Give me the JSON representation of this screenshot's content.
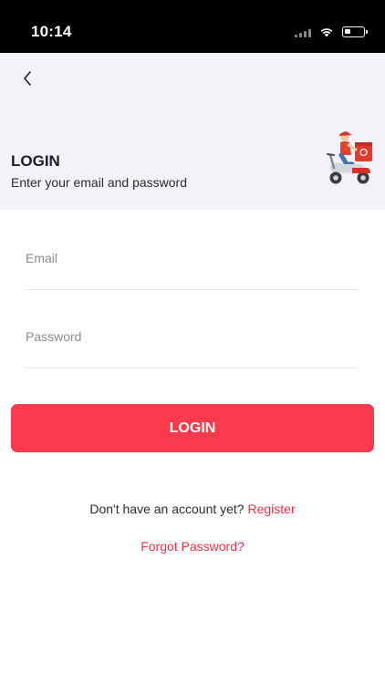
{
  "status_bar": {
    "time": "10:14"
  },
  "header": {
    "title": "LOGIN",
    "subtitle": "Enter your email and password"
  },
  "form": {
    "email_placeholder": "Email",
    "email_value": "",
    "password_placeholder": "Password",
    "password_value": ""
  },
  "actions": {
    "login_label": "LOGIN",
    "register_prompt": "Don't have an account yet? ",
    "register_link": "Register",
    "forgot_link": "Forgot Password?"
  },
  "colors": {
    "accent": "#fc3a4d",
    "link": "#e8344a",
    "header_bg": "#f2f2f8"
  },
  "icons": {
    "back": "chevron-left-icon",
    "illustration": "delivery-scooter-illustration"
  }
}
